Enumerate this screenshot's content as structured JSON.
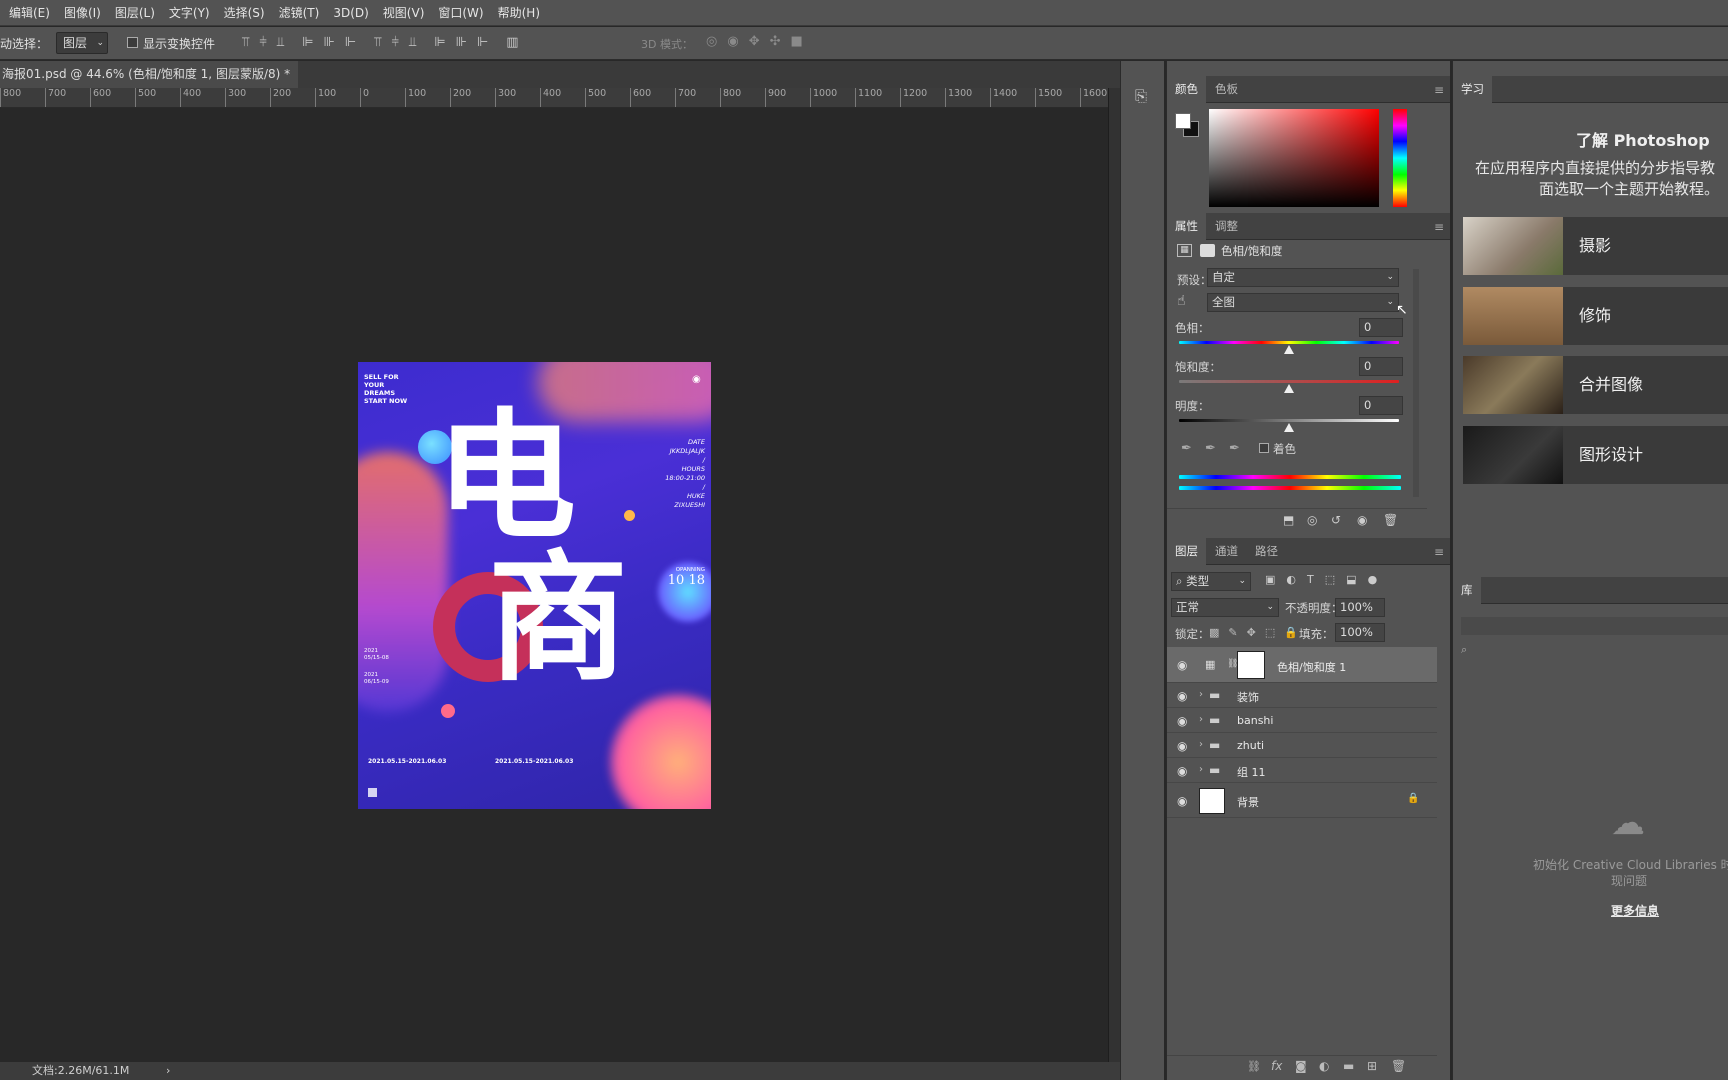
{
  "menubar": {
    "items": [
      "编辑(E)",
      "图像(I)",
      "图层(L)",
      "文字(Y)",
      "选择(S)",
      "滤镜(T)",
      "3D(D)",
      "视图(V)",
      "窗口(W)",
      "帮助(H)"
    ]
  },
  "options": {
    "auto_select_label": "动选择：",
    "auto_select_value": "图层",
    "show_transform_label": "显示变换控件",
    "mode3d_label": "3D 模式："
  },
  "document": {
    "tab_title": "海报01.psd @ 44.6% (色相/饱和度 1, 图层蒙版/8) *",
    "close": "×"
  },
  "ruler": {
    "labels": [
      "800",
      "700",
      "600",
      "500",
      "400",
      "300",
      "200",
      "100",
      "0",
      "100",
      "200",
      "300",
      "400",
      "500",
      "600",
      "700",
      "800",
      "900",
      "1000",
      "1100",
      "1200",
      "1300",
      "1400",
      "1500",
      "1600"
    ]
  },
  "poster": {
    "top_text": [
      "SELL FOR",
      "YOUR",
      "DREAMS",
      "START NOW"
    ],
    "big_char_1": "电",
    "big_char_2": "商",
    "right_info": [
      "DATE",
      "JKKDLJALJK",
      "/",
      "HOURS",
      "18:00-21:00",
      "/",
      "HUKE",
      "ZIXUESHI"
    ],
    "opening_label": "OPANNING",
    "opening_date": "10 18",
    "left_dates": [
      "2021",
      "05/15-08",
      "2021",
      "06/15-09"
    ],
    "bottom_date_1": "2021.05.15-2021.06.03",
    "bottom_date_2": "2021.05.15-2021.06.03"
  },
  "status": {
    "doc_info": "文档:2.26M/61.1M",
    "arrow": "›"
  },
  "color_panel": {
    "tabs": [
      "颜色",
      "色板"
    ]
  },
  "properties_panel": {
    "tabs": [
      "属性",
      "调整"
    ],
    "title": "色相/饱和度",
    "preset_label": "预设：",
    "preset_value": "自定",
    "channel_value": "全图",
    "hue_label": "色相：",
    "hue_value": "0",
    "saturation_label": "饱和度：",
    "saturation_value": "0",
    "lightness_label": "明度：",
    "lightness_value": "0",
    "colorize_label": "着色"
  },
  "layers_panel": {
    "tabs": [
      "图层",
      "通道",
      "路径"
    ],
    "filter_label": "类型",
    "blend_mode": "正常",
    "opacity_label": "不透明度：",
    "opacity_value": "100%",
    "lock_label": "锁定：",
    "fill_label": "填充：",
    "fill_value": "100%",
    "layers": [
      {
        "name": "色相/饱和度 1",
        "type": "adjustment"
      },
      {
        "name": "装饰",
        "type": "group"
      },
      {
        "name": "banshi",
        "type": "group"
      },
      {
        "name": "zhuti",
        "type": "group"
      },
      {
        "name": "组 11",
        "type": "group"
      },
      {
        "name": "背景",
        "type": "background"
      }
    ]
  },
  "learn_panel": {
    "tab": "学习",
    "title": "了解 Photoshop",
    "desc_1": "在应用程序内直接提供的分步指导教",
    "desc_2": "面选取一个主题开始教程。",
    "cards": [
      "摄影",
      "修饰",
      "合并图像",
      "图形设计"
    ]
  },
  "library_panel": {
    "tab": "库",
    "message_1": "初始化 Creative Cloud Libraries 时出",
    "message_2": "现问题",
    "more_info": "更多信息"
  }
}
